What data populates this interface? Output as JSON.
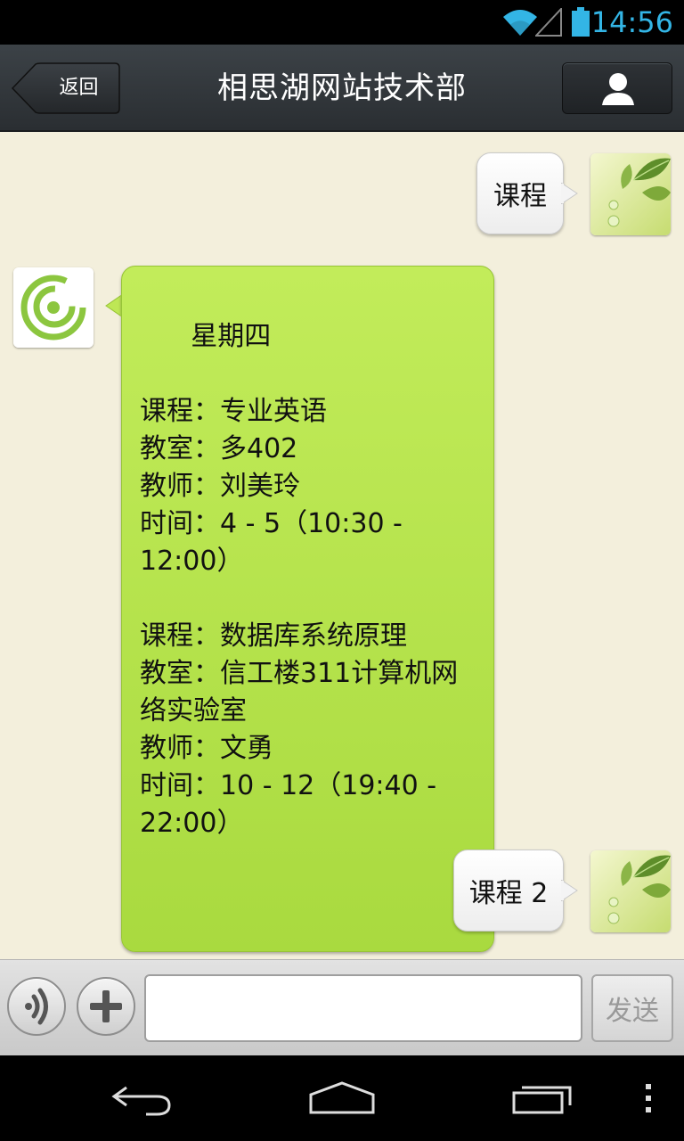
{
  "status_bar": {
    "time": "14:56",
    "icons": [
      "wifi-icon",
      "signal-icon",
      "battery-icon"
    ],
    "accent_color": "#33b5e5"
  },
  "title_bar": {
    "back_label": "返回",
    "title": "相思湖网站技术部",
    "profile_icon": "person-icon"
  },
  "messages": [
    {
      "direction": "outgoing",
      "text": "课程",
      "avatar": "leaf-avatar"
    },
    {
      "direction": "incoming",
      "avatar": "green-swirl-logo",
      "text": "星期四\n\n课程：专业英语\n教室：多402\n教师：刘美玲\n时间：4 - 5（10:30 - 12:00）\n\n课程：数据库系统原理\n教室：信工楼311计算机网络实验室\n教师：文勇\n时间：10 - 12（19:40 - 22:00）"
    },
    {
      "direction": "outgoing",
      "text": "课程 2",
      "avatar": "leaf-avatar"
    }
  ],
  "input_bar": {
    "voice_icon": "voice-icon",
    "plus_icon": "plus-icon",
    "input_value": "",
    "send_label": "发送"
  },
  "nav_bar": {
    "icons": [
      "back-arrow-icon",
      "home-icon",
      "recent-apps-icon",
      "menu-dots-icon"
    ]
  },
  "colors": {
    "chat_background": "#f3efdc",
    "incoming_bubble": "#b4e14a",
    "outgoing_bubble": "#ffffff",
    "title_bar": "#33383c"
  }
}
